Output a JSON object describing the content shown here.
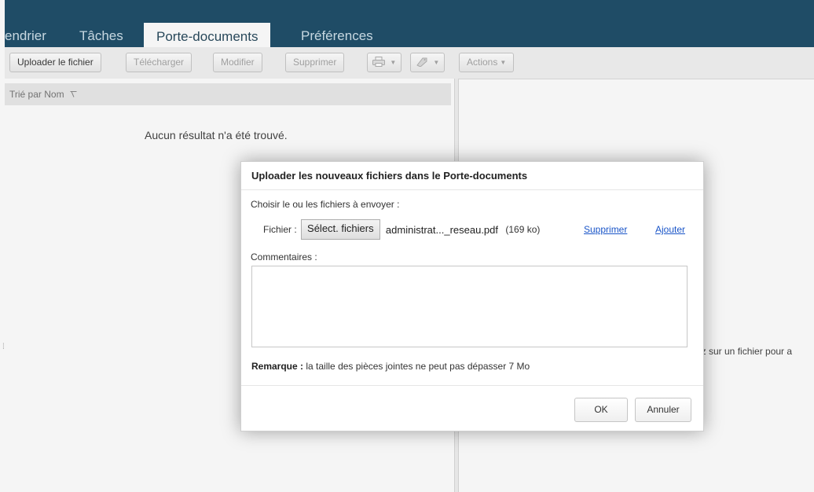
{
  "tabs": [
    {
      "label": "endrier",
      "active": false
    },
    {
      "label": "Tâches",
      "active": false
    },
    {
      "label": "Porte-documents",
      "active": true
    },
    {
      "label": "Préférences",
      "active": false
    }
  ],
  "toolbar": {
    "upload": "Uploader le fichier",
    "download": "Télécharger",
    "edit": "Modifier",
    "delete": "Supprimer",
    "print_icon": "printer-icon",
    "tag_icon": "tag-icon",
    "actions": "Actions"
  },
  "list": {
    "sort_label": "Trié par Nom",
    "empty_message": "Aucun résultat n'a été trouvé."
  },
  "preview_hint": "ez sur un fichier pour a",
  "dialog": {
    "title": "Uploader les nouveaux fichiers dans le Porte-documents",
    "choose_label": "Choisir le ou les fichiers à envoyer :",
    "file_label": "Fichier :",
    "select_button": "Sélect. fichiers",
    "file_name": "administrat..._reseau.pdf",
    "file_size": "(169 ko)",
    "remove_link": "Supprimer",
    "add_link": "Ajouter",
    "comments_label": "Commentaires :",
    "comments_value": "",
    "remark_label": "Remarque :",
    "remark_text": "la taille des pièces jointes ne peut pas dépasser 7 Mo",
    "ok_button": "OK",
    "cancel_button": "Annuler"
  },
  "colors": {
    "tabbar": "#21506b",
    "link": "#1a55c8"
  }
}
